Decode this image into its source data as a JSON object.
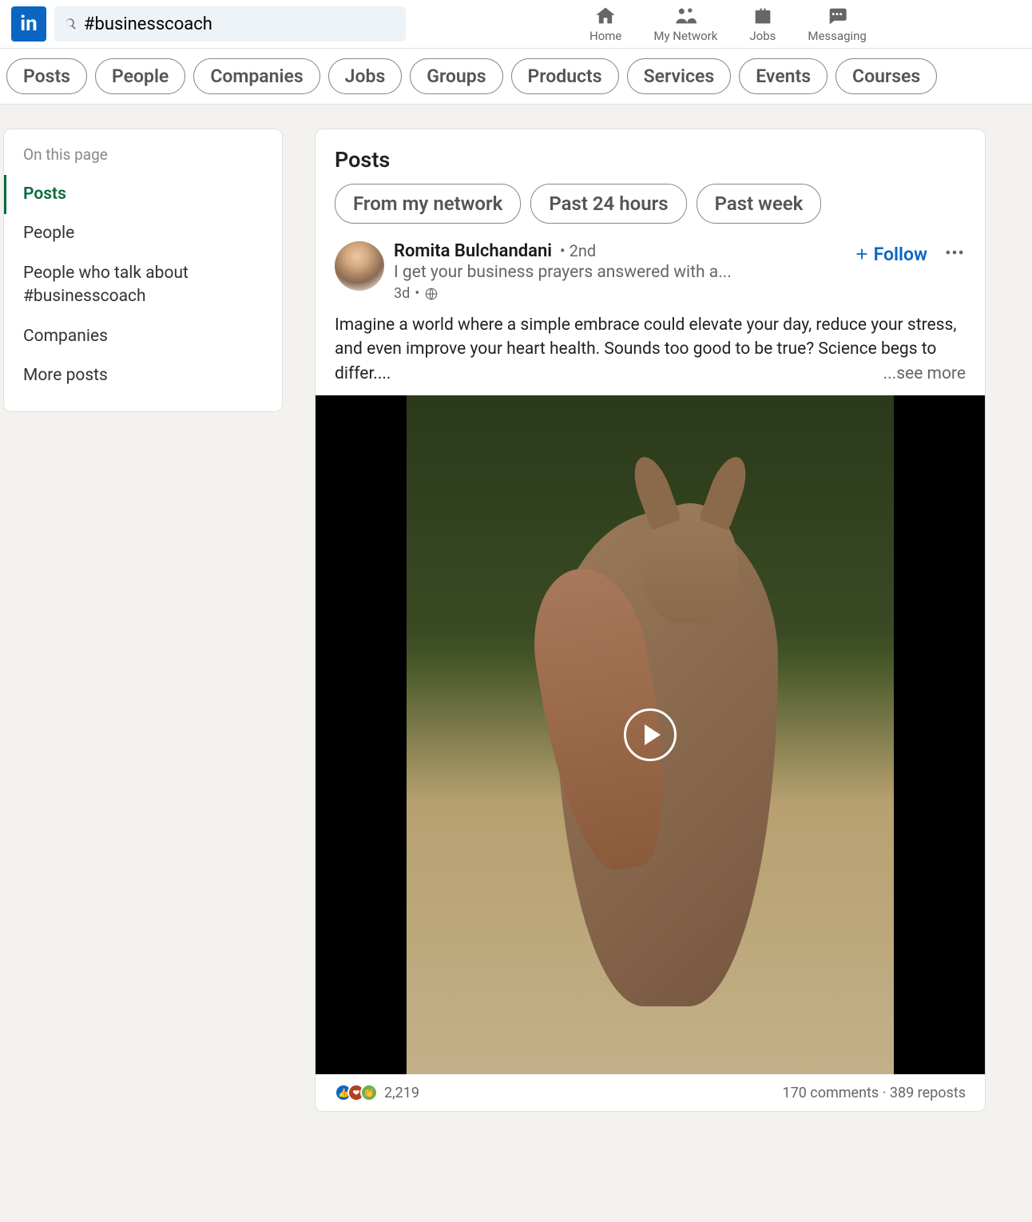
{
  "header": {
    "search_value": "#businesscoach",
    "nav": [
      {
        "label": "Home"
      },
      {
        "label": "My Network"
      },
      {
        "label": "Jobs"
      },
      {
        "label": "Messaging"
      }
    ]
  },
  "filters": [
    "Posts",
    "People",
    "Companies",
    "Jobs",
    "Groups",
    "Products",
    "Services",
    "Events",
    "Courses"
  ],
  "sidebar": {
    "title": "On this page",
    "items": [
      {
        "label": "Posts",
        "active": true
      },
      {
        "label": "People"
      },
      {
        "label": "People who talk about #businesscoach"
      },
      {
        "label": "Companies"
      },
      {
        "label": "More posts"
      }
    ]
  },
  "main": {
    "title": "Posts",
    "sub_filters": [
      "From my network",
      "Past 24 hours",
      "Past week"
    ]
  },
  "post": {
    "author": "Romita Bulchandani",
    "degree": "2nd",
    "tagline": "I get your business prayers answered with a...",
    "time": "3d",
    "follow": "Follow",
    "body": "Imagine a world where a simple embrace could elevate your day, reduce your stress, and even improve your heart health. Sounds too good to be true? Science begs to differ....",
    "see_more": "...see more",
    "reactions_count": "2,219",
    "comments": "170 comments",
    "reposts": "389 reposts"
  }
}
